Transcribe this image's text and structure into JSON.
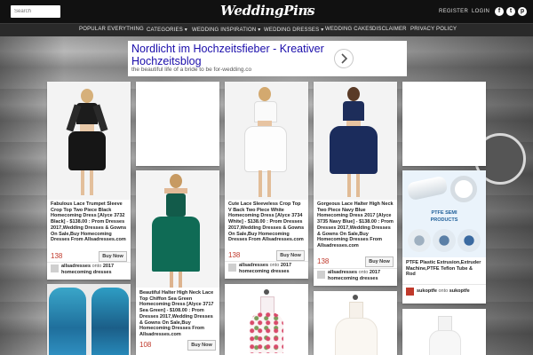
{
  "header": {
    "search_placeholder": "Search",
    "logo": "WeddingPins",
    "links": {
      "register": "REGISTER",
      "login": "LOGIN"
    },
    "social": [
      "f",
      "t",
      "p"
    ]
  },
  "nav": {
    "items": [
      "POPULAR",
      "EVERYTHING",
      "CATEGORIES ▾",
      "WEDDING INSPIRATION ▾",
      "WEDDING DRESSES ▾",
      "WEDDING CAKES",
      "DISCLAIMER",
      "PRIVACY POLICY"
    ]
  },
  "ad": {
    "title": "Nordlicht im Hochzeitsfieber - Kreativer Hochzeitsblog",
    "subtitle": "the beautiful life of a bride to be for-wedding.co"
  },
  "pins": [
    {
      "desc": "Fabulous Lace Trumpet Sleeve Crop Top Two Piece Black Homecoming Dress [Alyce 3732 Black] - $138.00 : Prom Dresses 2017,Wedding Dresses & Gowns On Sale,Buy Homecoming Dresses From Allsadresses.com",
      "price": "138",
      "buy": "Buy Now",
      "user": "allsadresses",
      "onto": "onto",
      "board": "2017 homecoming dresses"
    },
    {
      "desc": "Beautiful Halter High Neck Lace Top Chiffon Sea Green Homecoming Dress [Alyce 3717 Sea Green] - $108.00 : Prom Dresses 2017,Wedding Dresses & Gowns On Sale,Buy Homecoming Dresses From Allsadresses.com",
      "price": "108",
      "buy": "Buy Now"
    },
    {
      "desc": "Cute Lace Sleeveless Crop Top V Back Two Piece White Homecoming Dress [Alyce 3734 White] - $138.00 : Prom Dresses 2017,Wedding Dresses & Gowns On Sale,Buy Homecoming Dresses From Allsadresses.com",
      "price": "138",
      "buy": "Buy Now",
      "user": "allsadresses",
      "onto": "onto",
      "board": "2017 homecoming dresses"
    },
    {
      "desc": "Gorgeous Lace Halter High Neck Two Piece Navy Blue Homecoming Dress 2017 [Alyce 3735 Navy Blue] - $138.00 : Prom Dresses 2017,Wedding Dresses & Gowns On Sale,Buy Homecoming Dresses From Allsadresses.com",
      "price": "138",
      "buy": "Buy Now",
      "user": "allsadresses",
      "onto": "onto",
      "board": "2017 homecoming dresses"
    },
    {
      "desc": "PTFE Plastic Extrusion,Extruder Machine,PTFE Teflon Tube & Rod",
      "product_label": "PTFE SEMI PRODUCTS",
      "user": "sukoptfe",
      "onto": "onto",
      "board": "sukoptfe"
    }
  ],
  "colors": {
    "price": "#c0392b",
    "nav_bg": "#2a2a2a",
    "top_bg": "#111111"
  }
}
